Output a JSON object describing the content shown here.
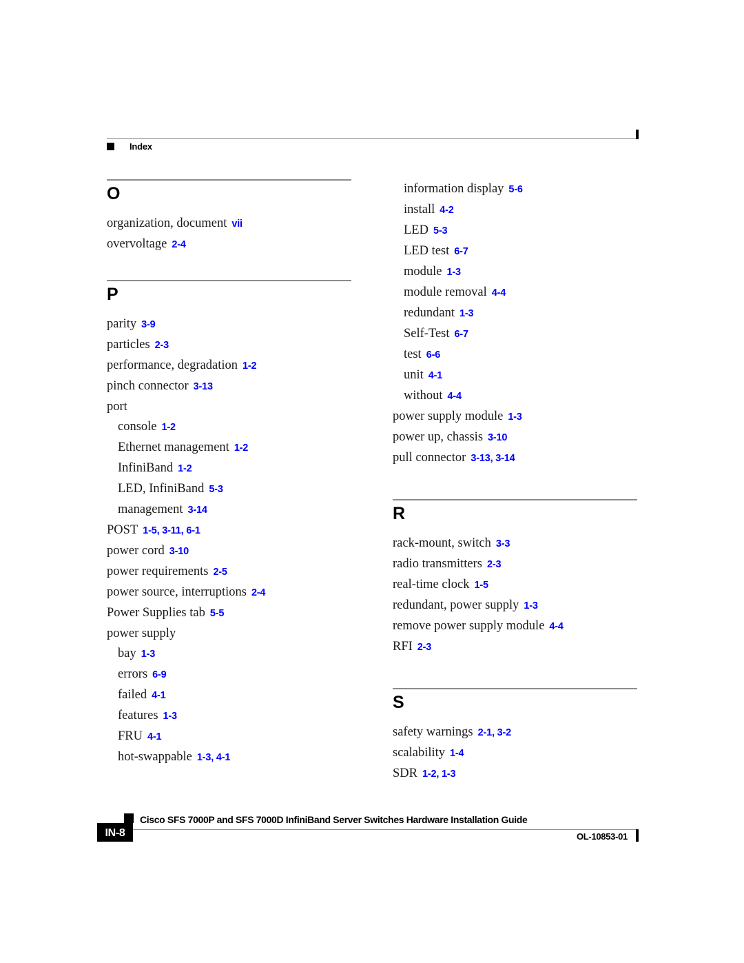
{
  "header": {
    "label": "Index",
    "square_icon": "black-square-marker"
  },
  "footer": {
    "page_number": "IN-8",
    "title": "Cisco SFS 7000P and SFS 7000D InfiniBand Server Switches Hardware Installation Guide",
    "doc_id": "OL-10853-01",
    "square_icon": "black-square-marker"
  },
  "colors": {
    "page_reference": "#0000ff",
    "rule": "#8c8c8c",
    "text": "#1a1a1a"
  },
  "columns": {
    "left": {
      "sections": [
        {
          "letter": "O",
          "entries": [
            {
              "level": 1,
              "term": "organization, document",
              "pages": "vii"
            },
            {
              "level": 1,
              "term": "overvoltage",
              "pages": "2-4"
            }
          ]
        },
        {
          "letter": "P",
          "entries": [
            {
              "level": 1,
              "term": "parity",
              "pages": "3-9"
            },
            {
              "level": 1,
              "term": "particles",
              "pages": "2-3"
            },
            {
              "level": 1,
              "term": "performance, degradation",
              "pages": "1-2"
            },
            {
              "level": 1,
              "term": "pinch connector",
              "pages": "3-13"
            },
            {
              "level": 1,
              "term": "port",
              "pages": ""
            },
            {
              "level": 2,
              "term": "console",
              "pages": "1-2"
            },
            {
              "level": 2,
              "term": "Ethernet management",
              "pages": "1-2"
            },
            {
              "level": 2,
              "term": "InfiniBand",
              "pages": "1-2"
            },
            {
              "level": 2,
              "term": "LED, InfiniBand",
              "pages": "5-3"
            },
            {
              "level": 2,
              "term": "management",
              "pages": "3-14"
            },
            {
              "level": 1,
              "term": "POST",
              "pages": "1-5, 3-11, 6-1"
            },
            {
              "level": 1,
              "term": "power cord",
              "pages": "3-10"
            },
            {
              "level": 1,
              "term": "power requirements",
              "pages": "2-5"
            },
            {
              "level": 1,
              "term": "power source, interruptions",
              "pages": "2-4"
            },
            {
              "level": 1,
              "term": "Power Supplies tab",
              "pages": "5-5"
            },
            {
              "level": 1,
              "term": "power supply",
              "pages": ""
            },
            {
              "level": 2,
              "term": "bay",
              "pages": "1-3"
            },
            {
              "level": 2,
              "term": "errors",
              "pages": "6-9"
            },
            {
              "level": 2,
              "term": "failed",
              "pages": "4-1"
            },
            {
              "level": 2,
              "term": "features",
              "pages": "1-3"
            },
            {
              "level": 2,
              "term": "FRU",
              "pages": "4-1"
            },
            {
              "level": 2,
              "term": "hot-swappable",
              "pages": "1-3, 4-1"
            }
          ]
        }
      ]
    },
    "right": {
      "continued_entries": [
        {
          "level": 2,
          "term": "information display",
          "pages": "5-6"
        },
        {
          "level": 2,
          "term": "install",
          "pages": "4-2"
        },
        {
          "level": 2,
          "term": "LED",
          "pages": "5-3"
        },
        {
          "level": 2,
          "term": "LED test",
          "pages": "6-7"
        },
        {
          "level": 2,
          "term": "module",
          "pages": "1-3"
        },
        {
          "level": 2,
          "term": "module removal",
          "pages": "4-4"
        },
        {
          "level": 2,
          "term": "redundant",
          "pages": "1-3"
        },
        {
          "level": 2,
          "term": "Self-Test",
          "pages": "6-7"
        },
        {
          "level": 2,
          "term": "test",
          "pages": "6-6"
        },
        {
          "level": 2,
          "term": "unit",
          "pages": "4-1"
        },
        {
          "level": 2,
          "term": "without",
          "pages": "4-4"
        },
        {
          "level": 1,
          "term": "power supply module",
          "pages": "1-3"
        },
        {
          "level": 1,
          "term": "power up, chassis",
          "pages": "3-10"
        },
        {
          "level": 1,
          "term": "pull connector",
          "pages": "3-13, 3-14"
        }
      ],
      "sections": [
        {
          "letter": "R",
          "entries": [
            {
              "level": 1,
              "term": "rack-mount, switch",
              "pages": "3-3"
            },
            {
              "level": 1,
              "term": "radio transmitters",
              "pages": "2-3"
            },
            {
              "level": 1,
              "term": "real-time clock",
              "pages": "1-5"
            },
            {
              "level": 1,
              "term": "redundant, power supply",
              "pages": "1-3"
            },
            {
              "level": 1,
              "term": "remove power supply module",
              "pages": "4-4"
            },
            {
              "level": 1,
              "term": "RFI",
              "pages": "2-3"
            }
          ]
        },
        {
          "letter": "S",
          "entries": [
            {
              "level": 1,
              "term": "safety warnings",
              "pages": "2-1, 3-2"
            },
            {
              "level": 1,
              "term": "scalability",
              "pages": "1-4"
            },
            {
              "level": 1,
              "term": "SDR",
              "pages": "1-2, 1-3"
            }
          ]
        }
      ]
    }
  }
}
